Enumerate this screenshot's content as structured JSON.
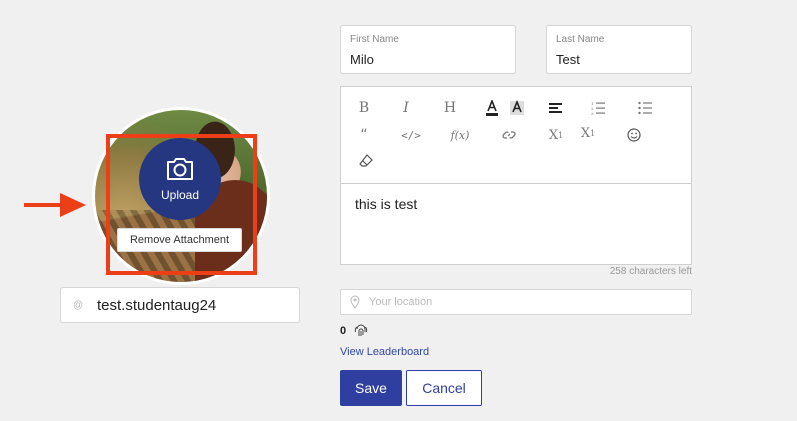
{
  "avatar": {
    "upload_label": "Upload",
    "remove_label": "Remove Attachment"
  },
  "username": {
    "value": "test.studentaug24"
  },
  "first_name": {
    "label": "First Name",
    "value": "Milo"
  },
  "last_name": {
    "label": "Last Name",
    "value": "Test"
  },
  "editor": {
    "toolbar_icons": [
      "bold-icon",
      "italic-icon",
      "heading-icon",
      "text-color-icon",
      "highlight-color-icon",
      "align-left-icon",
      "ordered-list-icon",
      "bullet-list-icon",
      "blockquote-icon",
      "code-icon",
      "formula-icon",
      "link-icon",
      "subscript-icon",
      "superscript-icon",
      "emoji-icon",
      "clear-format-icon"
    ],
    "content": "this is test",
    "chars_left": "258 characters left"
  },
  "location": {
    "placeholder": "Your location",
    "value": ""
  },
  "points": {
    "value": "0"
  },
  "leaderboard_link": "View Leaderboard",
  "actions": {
    "save": "Save",
    "cancel": "Cancel"
  },
  "colors": {
    "primary": "#2f3fa0",
    "upload_circle": "#253780",
    "highlight": "#ec3f18"
  }
}
